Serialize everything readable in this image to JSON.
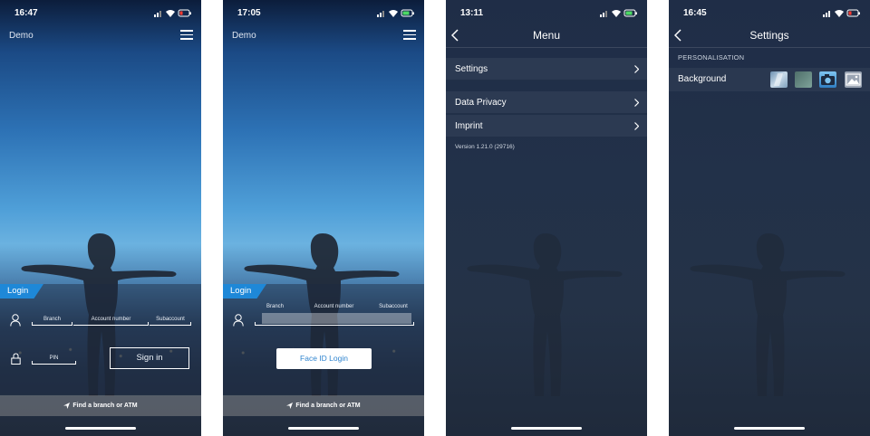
{
  "screens": [
    {
      "status_time": "16:47",
      "header_title": "Demo",
      "login_tab": "Login",
      "fields": {
        "branch": "Branch",
        "account": "Account number",
        "subaccount": "Subaccount",
        "pin": "PIN"
      },
      "signin_label": "Sign in",
      "find_label": "Find a branch or ATM"
    },
    {
      "status_time": "17:05",
      "header_title": "Demo",
      "login_tab": "Login",
      "fields": {
        "branch": "Branch",
        "account": "Account number",
        "subaccount": "Subaccount"
      },
      "faceid_label": "Face ID Login",
      "find_label": "Find a branch or ATM"
    },
    {
      "status_time": "13:11",
      "title": "Menu",
      "items": [
        {
          "label": "Settings"
        },
        {
          "label": "Data Privacy"
        },
        {
          "label": "Imprint"
        }
      ],
      "version": "Version 1.21.0 (29716)"
    },
    {
      "status_time": "16:45",
      "title": "Settings",
      "section": "PERSONALISATION",
      "row_label": "Background",
      "thumbnails": [
        "glass-thumbnail",
        "green-gradient-thumbnail",
        "camera-photo-thumbnail",
        "gallery-thumbnail"
      ]
    }
  ],
  "colors": {
    "accent_blue": "#1e88d8",
    "faceid_text": "#2f84cf",
    "battery_low": "#ff3b30",
    "battery_charge": "#4cd964"
  }
}
